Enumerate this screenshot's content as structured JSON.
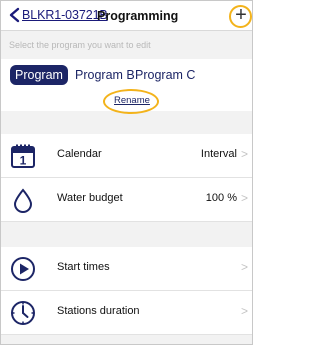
{
  "header": {
    "back_label": "BLKR1-03721B",
    "title": "Programming",
    "add_symbol": "+"
  },
  "subtitle": "Select the program you want to edit",
  "tabs": [
    {
      "label": "Program A",
      "selected": true
    },
    {
      "label": "Program B",
      "selected": false
    },
    {
      "label": "Program C",
      "selected": false
    }
  ],
  "rename_label": "Rename",
  "rows": [
    {
      "icon": "calendar-icon",
      "label": "Calendar",
      "value": "Interval"
    },
    {
      "icon": "water-drop-icon",
      "label": "Water budget",
      "value": "100 %"
    },
    {
      "icon": "play-circle-icon",
      "label": "Start times",
      "value": ""
    },
    {
      "icon": "clock-icon",
      "label": "Stations duration",
      "value": ""
    }
  ],
  "colors": {
    "brand": "#1c2566",
    "highlight_ring": "#f3b31b",
    "background": "#f2f2f2"
  }
}
